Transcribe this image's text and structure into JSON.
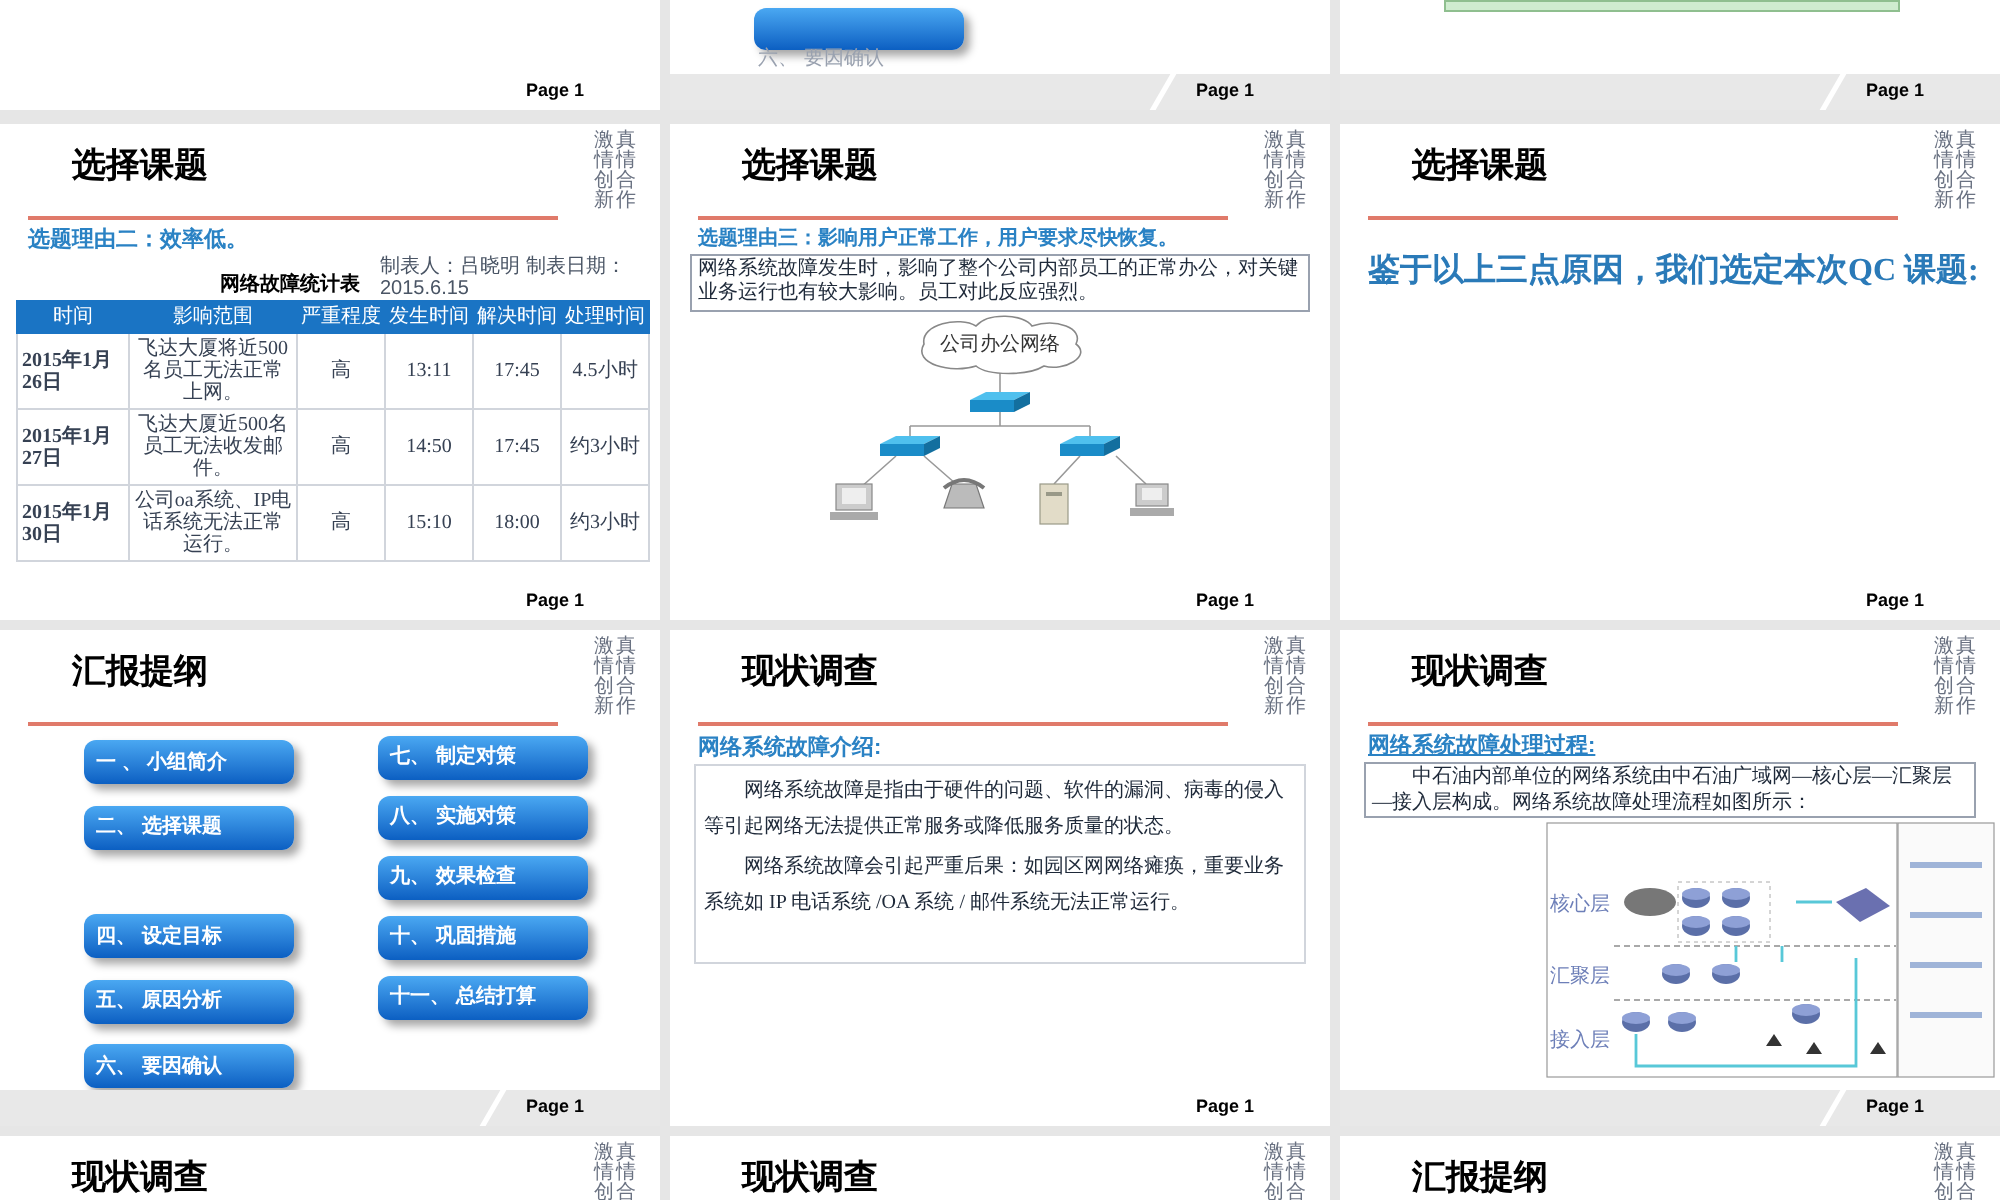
{
  "rows": [
    {
      "slides": [
        {
          "kind": "blank",
          "footer_band": false,
          "page": "Page 1"
        },
        {
          "kind": "outline_tail",
          "footer_band": true,
          "item": "六、 要因确认",
          "page": "Page 1"
        },
        {
          "kind": "table_tail",
          "footer_band": true,
          "page": "Page 1"
        }
      ]
    },
    {
      "slides": [
        {
          "kind": "table",
          "title": "选择课题",
          "side": [
            "激情创新",
            "真情合作"
          ],
          "subtitle": "选题理由二：效率低。",
          "table_title": "网络故障统计表",
          "table_note": "制表人：吕晓明 制表日期：2015.6.15",
          "columns": [
            "时间",
            "影响范围",
            "严重程度",
            "发生时间",
            "解决时间",
            "处理时间"
          ],
          "rows": [
            [
              "2015年1月26日",
              "飞达大厦将近500名员工无法正常上网。",
              "高",
              "13:11",
              "17:45",
              "4.5小时"
            ],
            [
              "2015年1月27日",
              "飞达大厦近500名员工无法收发邮件。",
              "高",
              "14:50",
              "17:45",
              "约3小时"
            ],
            [
              "2015年1月30日",
              "公司oa系统、IP电话系统无法正常运行。",
              "高",
              "15:10",
              "18:00",
              "约3小时"
            ]
          ],
          "footer_band": false,
          "page": "Page 1"
        },
        {
          "kind": "network",
          "title": "选择课题",
          "side": [
            "激情创新",
            "真情合作"
          ],
          "subtitle": "选题理由三：影响用户正常工作，用户要求尽快恢复。",
          "text": "网络系统故障发生时，影响了整个公司内部员工的正常办公，对关键业务运行也有较大影响。员工对此反应强烈。",
          "diagram_label": "公司办公网络",
          "footer_band": false,
          "page": "Page 1"
        },
        {
          "kind": "statement",
          "title": "选择课题",
          "side": [
            "激情创新",
            "真情合作"
          ],
          "text": "鉴于以上三点原因，我们选定本次QC 课题:",
          "footer_band": false,
          "page": "Page 1"
        }
      ]
    },
    {
      "slides": [
        {
          "kind": "outline",
          "title": "汇报提纲",
          "side": [
            "激情创新",
            "真情合作"
          ],
          "left": [
            "一 、 小组简介",
            "二、 选择课题",
            "四、 设定目标",
            "五、 原因分析",
            "六、 要因确认"
          ],
          "right": [
            "七、 制定对策",
            "八、 实施对策",
            "九、 效果检查",
            "十、 巩固措施",
            "十一、 总结打算"
          ],
          "footer_band": true,
          "page": "Page 1"
        },
        {
          "kind": "paragraphs",
          "title": "现状调查",
          "side": [
            "激情创新",
            "真情合作"
          ],
          "subtitle": "网络系统故障介绍:",
          "paragraphs": [
            "网络系统故障是指由于硬件的问题、软件的漏洞、病毒的侵入等引起网络无法提供正常服务或降低服务质量的状态。",
            "网络系统故障会引起严重后果：如园区网网络瘫痪，重要业务系统如 IP 电话系统 /OA 系统 / 邮件系统无法正常运行。"
          ],
          "footer_band": false,
          "page": "Page 1"
        },
        {
          "kind": "process",
          "title": "现状调查",
          "side": [
            "激情创新",
            "真情合作"
          ],
          "subtitle": "网络系统故障处理过程:",
          "text": "中石油内部单位的网络系统由中石油广域网—核心层—汇聚层—接入层构成。网络系统故障处理流程如图所示：",
          "layers": [
            "核心层",
            "汇聚层",
            "接入层"
          ],
          "footer_band": true,
          "page": "Page 1"
        }
      ]
    },
    {
      "slides": [
        {
          "kind": "heading",
          "title": "现状调查",
          "side": [
            "激情创",
            "真情合"
          ]
        },
        {
          "kind": "heading",
          "title": "现状调查",
          "side": [
            "激情创",
            "真情合"
          ]
        },
        {
          "kind": "heading",
          "title": "汇报提纲",
          "side": [
            "激情创",
            "真情合"
          ]
        }
      ]
    }
  ]
}
